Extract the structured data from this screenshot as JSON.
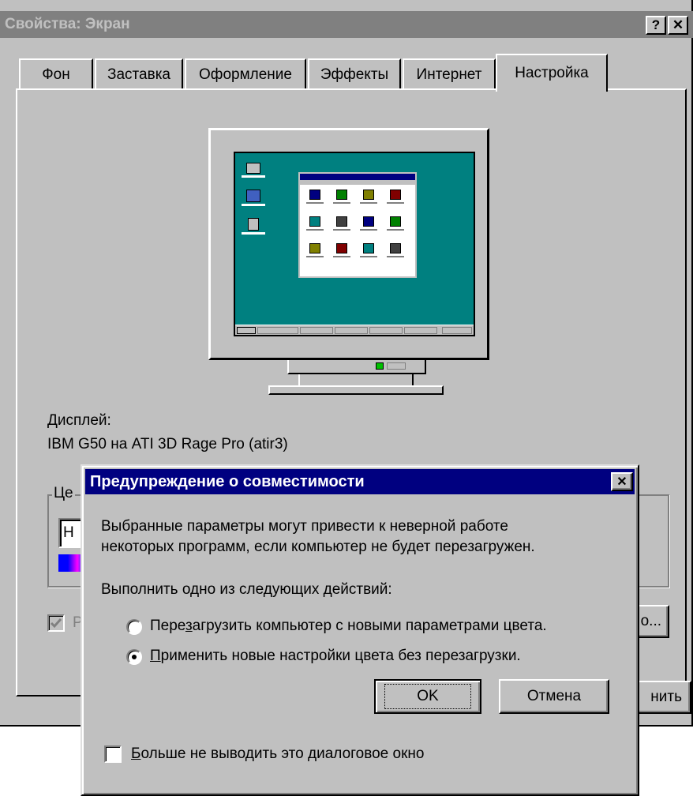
{
  "window": {
    "title": "Свойства: Экран",
    "help_glyph": "?",
    "close_glyph": "✕"
  },
  "tabs": [
    {
      "label": "Фон",
      "active": false
    },
    {
      "label": "Заставка",
      "active": false
    },
    {
      "label": "Оформление",
      "active": false
    },
    {
      "label": "Эффекты",
      "active": false
    },
    {
      "label": "Интернет",
      "active": false
    },
    {
      "label": "Настройка",
      "active": true
    }
  ],
  "display": {
    "label": "Дисплей:",
    "value": "IBM G50 на ATI 3D Rage Pro (atir3)"
  },
  "colors_group": {
    "label_partial": "Це",
    "combo_partial": "Н"
  },
  "hidden_partials": {
    "checkbox_label_partial": "Р",
    "advanced_button_partial": "о...",
    "apply_button_partial": "нить"
  },
  "dialog": {
    "title": "Предупреждение о совместимости",
    "close_glyph": "✕",
    "message_line1": "Выбранные параметры могут привести к неверной работе",
    "message_line2": "некоторых программ, если компьютер не будет перезагружен.",
    "prompt": "Выполнить одно из следующих действий:",
    "option1": {
      "pre": "Пере",
      "accel": "з",
      "post": "агрузить компьютер с новыми параметрами цвета.",
      "selected": false
    },
    "option2": {
      "pre": "",
      "accel": "П",
      "post": "рименить новые настройки цвета без перезагрузки.",
      "selected": true
    },
    "ok_label": "OK",
    "cancel_label": "Отмена",
    "dont_show": {
      "pre": "",
      "accel": "Б",
      "post": "ольше не выводить это диалоговое окно",
      "checked": false
    }
  },
  "preview_screen": {
    "desktop_icons": [
      "Мой компьютер",
      "Сетевое окружение",
      "Корзина"
    ],
    "window_icons": [
      "icon-1",
      "icon-2",
      "icon-3",
      "icon-4",
      "icon-5",
      "icon-6",
      "icon-7",
      "icon-8",
      "icon-9",
      "icon-10",
      "icon-11",
      "icon-12"
    ],
    "colors": {
      "desktop": "#008080",
      "window_title": "#000080"
    }
  }
}
